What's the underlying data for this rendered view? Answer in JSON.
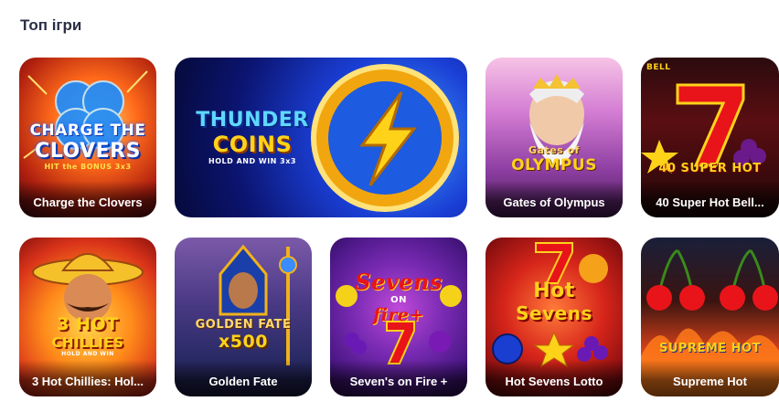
{
  "section": {
    "title": "Топ ігри"
  },
  "games": [
    {
      "name": "Charge the Clovers",
      "logo_lines": [
        "CHARGE THE",
        "CLOVERS",
        "HIT the BONUS 3x3"
      ]
    },
    {
      "name": "",
      "logo_lines": [
        "THUNDER",
        "COINS",
        "HOLD AND WIN 3x3"
      ]
    },
    {
      "name": "Gates of Olympus",
      "logo_lines": [
        "Gates of",
        "OLYMPUS"
      ]
    },
    {
      "name": "40 Super Hot Bell...",
      "logo_lines": [
        "BELL",
        "40 SUPER HOT"
      ]
    },
    {
      "name": "3 Hot Chillies: Hol...",
      "logo_lines": [
        "3 HOT",
        "CHILLIES",
        "HOLD AND WIN"
      ]
    },
    {
      "name": "Golden Fate",
      "logo_lines": [
        "GOLDEN FATE",
        "x500"
      ]
    },
    {
      "name": "Seven's on Fire +",
      "logo_lines": [
        "Sevens",
        "ON",
        "fire+"
      ]
    },
    {
      "name": "Hot Sevens Lotto",
      "logo_lines": [
        "Hot",
        "Sevens"
      ]
    },
    {
      "name": "Supreme Hot",
      "logo_lines": [
        "SUPREME HOT"
      ]
    }
  ],
  "colors": {
    "title": "#2a2f45",
    "label_text": "#ffffff"
  }
}
